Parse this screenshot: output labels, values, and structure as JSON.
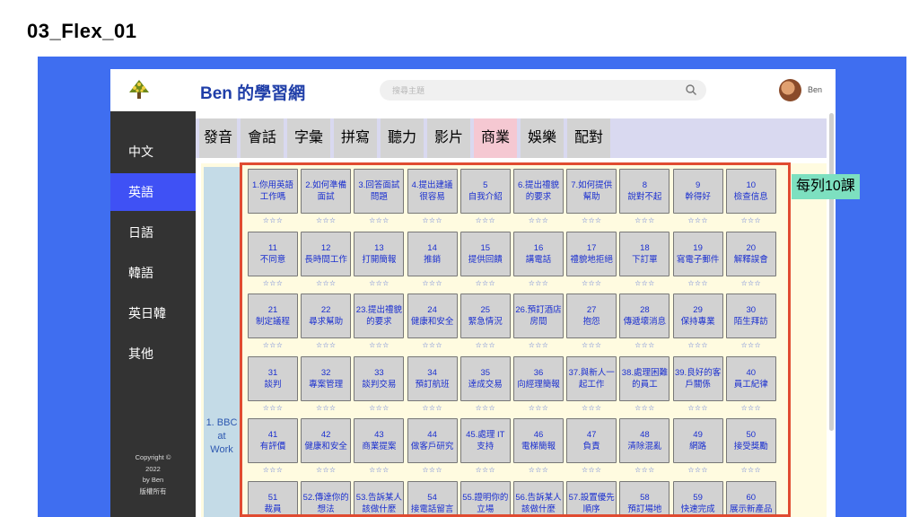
{
  "slide_title": "03_Flex_01",
  "header": {
    "site_title": "Ben 的學習網",
    "search_placeholder": "搜尋主題",
    "user_name": "Ben"
  },
  "sidebar": {
    "items": [
      {
        "label": "中文"
      },
      {
        "label": "英語"
      },
      {
        "label": "日語"
      },
      {
        "label": "韓語"
      },
      {
        "label": "英日韓"
      },
      {
        "label": "其他"
      }
    ],
    "active_index": 1,
    "copyright": [
      "Copyright ©",
      "2022",
      "by Ben",
      "版權所有"
    ]
  },
  "tabs": [
    "發音",
    "會話",
    "字彙",
    "拼寫",
    "聽力",
    "影片",
    "商業",
    "娛樂",
    "配對"
  ],
  "left_label": [
    "1. BBC",
    "at",
    "Work"
  ],
  "lessons": [
    "1.你用英語工作嗎",
    "2.如何準備面試",
    "3.回答面試問題",
    "4.提出建議很容易",
    "5\n自我介紹",
    "6.提出禮貌的要求",
    "7.如何提供幫助",
    "8\n說對不起",
    "9\n幹得好",
    "10\n檢查信息",
    "11\n不同意",
    "12\n長時間工作",
    "13\n打開簡報",
    "14\n推銷",
    "15\n提供回饋",
    "16\n講電話",
    "17\n禮貌地拒絕",
    "18\n下訂單",
    "19\n寫電子郵件",
    "20\n解釋誤會",
    "21\n制定議程",
    "22\n尋求幫助",
    "23.提出禮貌的要求",
    "24\n健康和安全",
    "25\n緊急情況",
    "26.預訂酒店房間",
    "27\n抱怨",
    "28\n傳遞壞消息",
    "29\n保持專業",
    "30\n陌生拜訪",
    "31\n談判",
    "32\n專案管理",
    "33\n談判交易",
    "34\n預訂航班",
    "35\n達成交易",
    "36\n向經理簡報",
    "37.與新人一起工作",
    "38.處理困難的員工",
    "39.良好的客戶關係",
    "40\n員工紀律",
    "41\n有評價",
    "42\n健康和安全",
    "43\n商業提案",
    "44\n做客戶研究",
    "45.處理 IT 支持",
    "46\n電梯簡報",
    "47\n負責",
    "48\n清除混亂",
    "49\n網路",
    "50\n接受獎勵",
    "51\n裁員",
    "52.傳達你的想法",
    "53.告訴某人該做什麼",
    "54\n接電話留言",
    "55.證明你的立場",
    "56.告訴某人該做什麼",
    "57.設置優先順序",
    "58\n預訂場地",
    "59\n快速完成",
    "60\n展示新產品"
  ],
  "stars": "☆☆☆",
  "note": "每列10課",
  "colors": {
    "accent_blue": "#3f51f5",
    "background_blue": "#3f6ef0",
    "frame_red": "#e04b31",
    "note_green": "#7de0c0",
    "lesson_text": "#1a2fd0"
  }
}
